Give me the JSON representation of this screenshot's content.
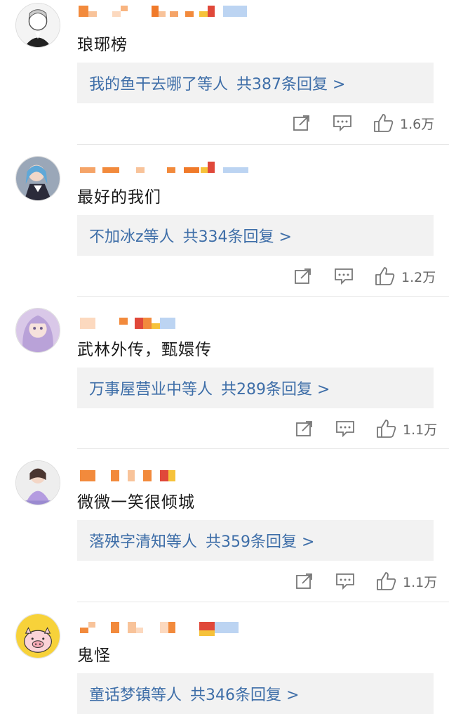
{
  "comments": [
    {
      "text": "琅琊榜",
      "reply": {
        "users": "我的鱼干去哪了等人",
        "summary": "共387条回复 >"
      },
      "likes": "1.6万"
    },
    {
      "text": "最好的我们",
      "reply": {
        "users": "不加冰z等人",
        "summary": "共334条回复 >"
      },
      "likes": "1.2万"
    },
    {
      "text": "武林外传，甄嬛传",
      "reply": {
        "users": "万事屋营业中等人",
        "summary": "共289条回复 >"
      },
      "likes": "1.1万"
    },
    {
      "text": "微微一笑很倾城",
      "reply": {
        "users": "落殃字清知等人",
        "summary": "共359条回复 >"
      },
      "likes": "1.1万"
    },
    {
      "text": "鬼怪",
      "reply": {
        "users": "童话梦镇等人",
        "summary": "共346条回复 >"
      },
      "likes": ""
    }
  ],
  "icons": {
    "share": "share-icon",
    "comment": "comment-icon",
    "like": "thumbs-up-icon"
  },
  "colors": {
    "link": "#3e6ea8",
    "reply_bg": "#f2f2f2",
    "divider": "#e6e6e6",
    "icon": "#777777"
  }
}
